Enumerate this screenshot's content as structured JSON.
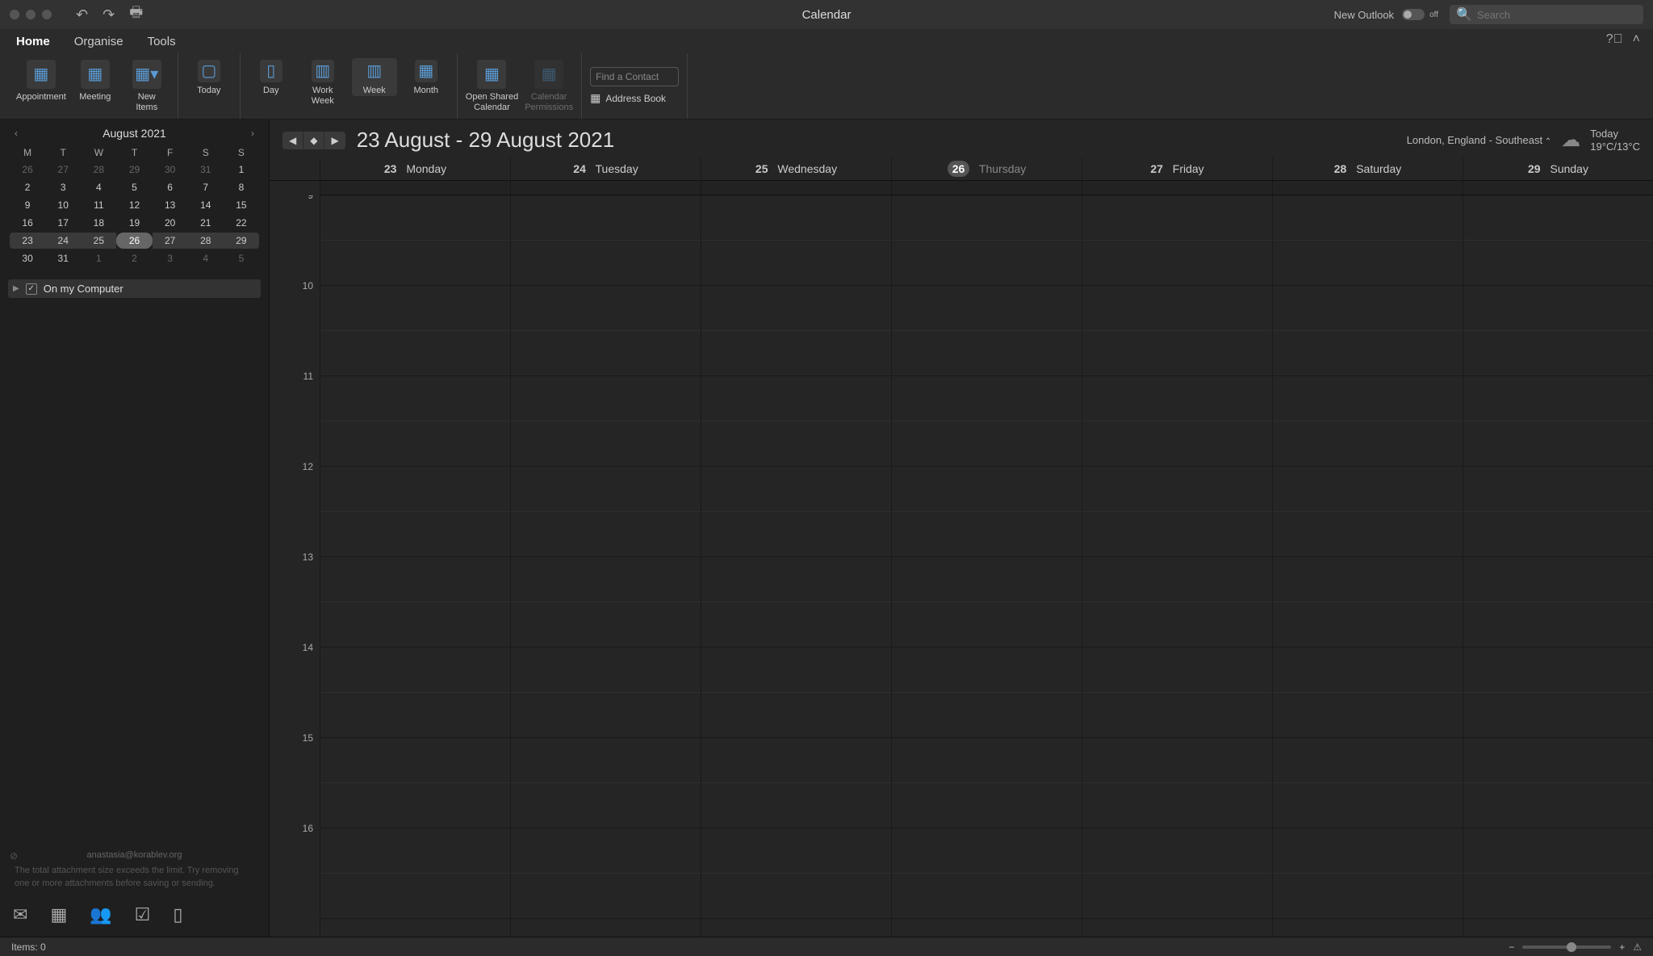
{
  "title": "Calendar",
  "newOutlook": {
    "label": "New Outlook",
    "toggle": "off"
  },
  "search": {
    "placeholder": "Search"
  },
  "tabs": [
    "Home",
    "Organise",
    "Tools"
  ],
  "activeTab": 0,
  "ribbon": {
    "appointment": "Appointment",
    "meeting": "Meeting",
    "newItems": "New\nItems",
    "today": "Today",
    "day": "Day",
    "workWeek": "Work\nWeek",
    "week": "Week",
    "month": "Month",
    "openShared": "Open Shared\nCalendar",
    "permissions": "Calendar\nPermissions",
    "findContact": "Find a Contact",
    "addressBook": "Address Book"
  },
  "miniCal": {
    "title": "August 2021",
    "headers": [
      "M",
      "T",
      "W",
      "T",
      "F",
      "S",
      "S"
    ],
    "weeks": [
      [
        {
          "n": "26",
          "dim": true
        },
        {
          "n": "27",
          "dim": true
        },
        {
          "n": "28",
          "dim": true
        },
        {
          "n": "29",
          "dim": true
        },
        {
          "n": "30",
          "dim": true
        },
        {
          "n": "31",
          "dim": true
        },
        {
          "n": "1"
        }
      ],
      [
        {
          "n": "2"
        },
        {
          "n": "3"
        },
        {
          "n": "4"
        },
        {
          "n": "5"
        },
        {
          "n": "6"
        },
        {
          "n": "7"
        },
        {
          "n": "8"
        }
      ],
      [
        {
          "n": "9"
        },
        {
          "n": "10"
        },
        {
          "n": "11"
        },
        {
          "n": "12"
        },
        {
          "n": "13"
        },
        {
          "n": "14"
        },
        {
          "n": "15"
        }
      ],
      [
        {
          "n": "16"
        },
        {
          "n": "17"
        },
        {
          "n": "18"
        },
        {
          "n": "19"
        },
        {
          "n": "20"
        },
        {
          "n": "21"
        },
        {
          "n": "22"
        }
      ],
      [
        {
          "n": "23"
        },
        {
          "n": "24"
        },
        {
          "n": "25"
        },
        {
          "n": "26",
          "today": true
        },
        {
          "n": "27"
        },
        {
          "n": "28"
        },
        {
          "n": "29"
        }
      ],
      [
        {
          "n": "30"
        },
        {
          "n": "31"
        },
        {
          "n": "1",
          "dim": true
        },
        {
          "n": "2",
          "dim": true
        },
        {
          "n": "3",
          "dim": true
        },
        {
          "n": "4",
          "dim": true
        },
        {
          "n": "5",
          "dim": true
        }
      ]
    ],
    "selectedWeek": 4
  },
  "tree": {
    "onMyComputer": "On my Computer"
  },
  "sideAlert": {
    "email": "anastasia@korablev.org",
    "msg": "The total attachment size exceeds the limit. Try removing one or more attachments before saving or sending."
  },
  "range": "23 August - 29 August 2021",
  "weather": {
    "location": "London, England - Southeast",
    "todayLabel": "Today",
    "temp": "19°C/13°C"
  },
  "days": [
    {
      "n": "23",
      "name": "Monday"
    },
    {
      "n": "24",
      "name": "Tuesday"
    },
    {
      "n": "25",
      "name": "Wednesday"
    },
    {
      "n": "26",
      "name": "Thursday",
      "today": true
    },
    {
      "n": "27",
      "name": "Friday"
    },
    {
      "n": "28",
      "name": "Saturday"
    },
    {
      "n": "29",
      "name": "Sunday"
    }
  ],
  "hours": [
    "9",
    "10",
    "11",
    "12",
    "13",
    "14",
    "15",
    "16"
  ],
  "status": {
    "items": "Items: 0"
  }
}
